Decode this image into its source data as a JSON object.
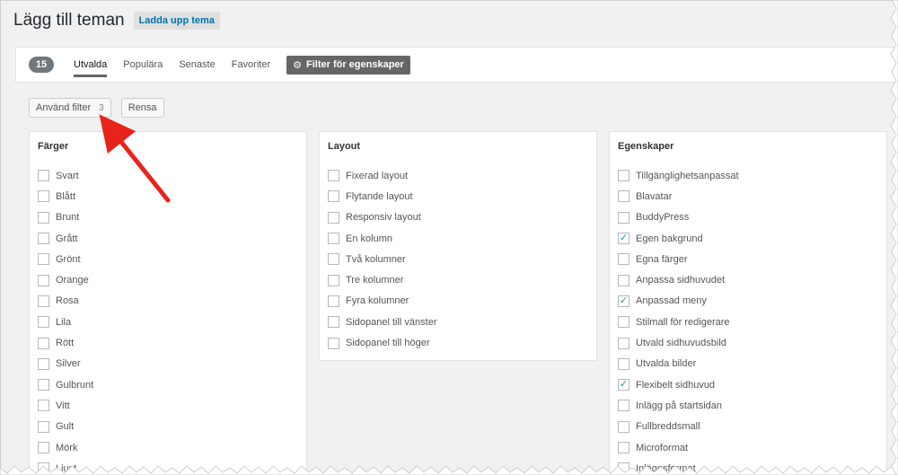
{
  "header": {
    "title": "Lägg till teman",
    "upload_label": "Ladda upp tema"
  },
  "filterbar": {
    "count": "15",
    "tabs": [
      {
        "label": "Utvalda",
        "current": true
      },
      {
        "label": "Populära",
        "current": false
      },
      {
        "label": "Senaste",
        "current": false
      },
      {
        "label": "Favoriter",
        "current": false
      }
    ],
    "feature_filter_label": "Filter för egenskaper"
  },
  "actions": {
    "apply_label": "Använd filter",
    "apply_count": "3",
    "clear_label": "Rensa"
  },
  "colors": {
    "accent": "#0073aa",
    "arrow": "#e8231b",
    "checkmark": "#1e8cbe"
  },
  "panels": [
    {
      "title": "Färger",
      "items": [
        {
          "label": "Svart",
          "checked": false
        },
        {
          "label": "Blått",
          "checked": false
        },
        {
          "label": "Brunt",
          "checked": false
        },
        {
          "label": "Grått",
          "checked": false
        },
        {
          "label": "Grönt",
          "checked": false
        },
        {
          "label": "Orange",
          "checked": false
        },
        {
          "label": "Rosa",
          "checked": false
        },
        {
          "label": "Lila",
          "checked": false
        },
        {
          "label": "Rött",
          "checked": false
        },
        {
          "label": "Silver",
          "checked": false
        },
        {
          "label": "Gulbrunt",
          "checked": false
        },
        {
          "label": "Vitt",
          "checked": false
        },
        {
          "label": "Gult",
          "checked": false
        },
        {
          "label": "Mörk",
          "checked": false
        },
        {
          "label": "Ljust",
          "checked": false
        }
      ]
    },
    {
      "title": "Layout",
      "items": [
        {
          "label": "Fixerad layout",
          "checked": false
        },
        {
          "label": "Flytande layout",
          "checked": false
        },
        {
          "label": "Responsiv layout",
          "checked": false
        },
        {
          "label": "En kolumn",
          "checked": false
        },
        {
          "label": "Två kolumner",
          "checked": false
        },
        {
          "label": "Tre kolumner",
          "checked": false
        },
        {
          "label": "Fyra kolumner",
          "checked": false
        },
        {
          "label": "Sidopanel till vänster",
          "checked": false
        },
        {
          "label": "Sidopanel till höger",
          "checked": false
        }
      ]
    },
    {
      "title": "Egenskaper",
      "items": [
        {
          "label": "Tillgänglighetsanpassat",
          "checked": false
        },
        {
          "label": "Blavatar",
          "checked": false
        },
        {
          "label": "BuddyPress",
          "checked": false
        },
        {
          "label": "Egen bakgrund",
          "checked": true
        },
        {
          "label": "Egna färger",
          "checked": false
        },
        {
          "label": "Anpassa sidhuvudet",
          "checked": false
        },
        {
          "label": "Anpassad meny",
          "checked": true
        },
        {
          "label": "Stilmall för redigerare",
          "checked": false
        },
        {
          "label": "Utvald sidhuvudsbild",
          "checked": false
        },
        {
          "label": "Utvalda bilder",
          "checked": false
        },
        {
          "label": "Flexibelt sidhuvud",
          "checked": true
        },
        {
          "label": "Inlägg på startsidan",
          "checked": false
        },
        {
          "label": "Fullbreddsmall",
          "checked": false
        },
        {
          "label": "Microformat",
          "checked": false
        },
        {
          "label": "Inläggsformat",
          "checked": false
        }
      ]
    }
  ]
}
